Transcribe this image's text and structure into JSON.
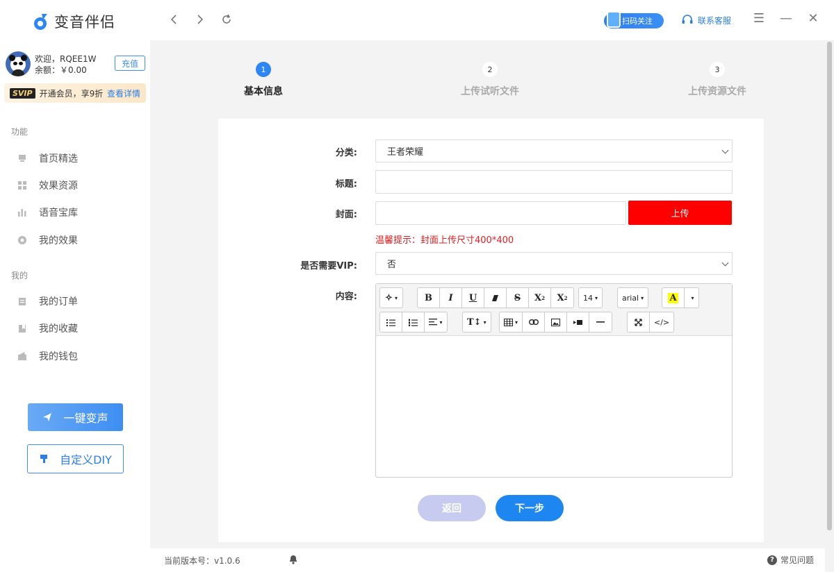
{
  "app": {
    "title": "变音伴侣",
    "accent": "#2e86f5"
  },
  "topbar": {
    "nav": {
      "back_icon": "chevron-left-icon",
      "forward_icon": "chevron-right-icon",
      "refresh_icon": "refresh-icon"
    },
    "scan_label": "扫码关注",
    "service_label": "联系客服",
    "controls": {
      "menu": "☰",
      "minimize": "—",
      "close": "✕"
    }
  },
  "user": {
    "welcome": "欢迎，RQEE1W",
    "balance": "余额：￥0.00",
    "recharge_label": "充值"
  },
  "vip": {
    "badge": "SVIP",
    "text": "开通会员，享9折",
    "link": "查看详情"
  },
  "sidebar": {
    "section_functions": "功能",
    "functions": [
      {
        "label": "首页精选",
        "icon": "home-icon"
      },
      {
        "label": "效果资源",
        "icon": "grid-icon"
      },
      {
        "label": "语音宝库",
        "icon": "bars-icon"
      },
      {
        "label": "我的效果",
        "icon": "circle-icon"
      }
    ],
    "section_mine": "我的",
    "mine": [
      {
        "label": "我的订单",
        "icon": "clipboard-icon"
      },
      {
        "label": "我的收藏",
        "icon": "bookmark-icon"
      },
      {
        "label": "我的钱包",
        "icon": "wallet-icon"
      }
    ],
    "voice_button": "一键变声",
    "diy_button": "自定义DIY"
  },
  "steps": [
    {
      "num": "1",
      "label": "基本信息",
      "active": true
    },
    {
      "num": "2",
      "label": "上传试听文件",
      "active": false
    },
    {
      "num": "3",
      "label": "上传资源文件",
      "active": false
    }
  ],
  "form": {
    "category_label": "分类:",
    "category_value": "王者荣耀",
    "title_label": "标题:",
    "title_value": "",
    "cover_label": "封面:",
    "cover_value": "",
    "upload_label": "上传",
    "hint": "温馨提示：封面上传尺寸400*400",
    "vip_label": "是否需要VIP:",
    "vip_value": "否",
    "content_label": "内容:"
  },
  "editor": {
    "font_size": "14",
    "font_family": "arial",
    "highlight_letter": "A"
  },
  "buttons": {
    "back": "返回",
    "next": "下一步"
  },
  "footer": {
    "version": "当前版本号：v1.0.6",
    "faq": "常见问题"
  }
}
